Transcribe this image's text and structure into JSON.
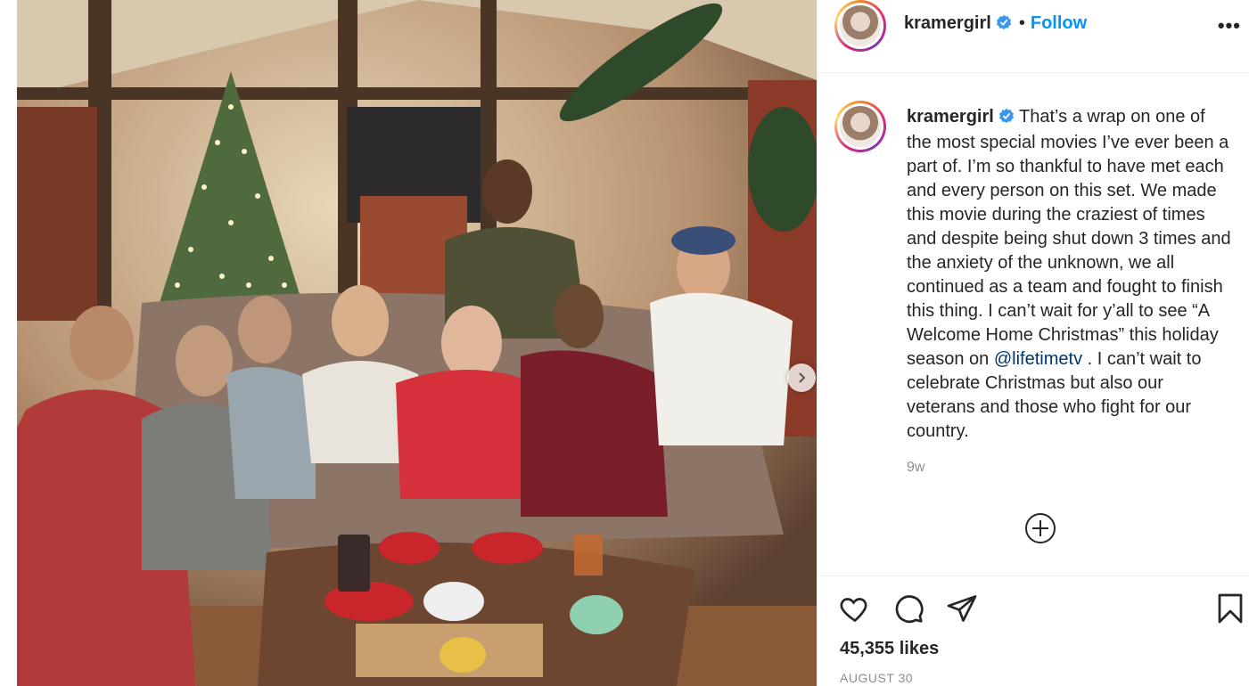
{
  "post": {
    "username": "kramergirl",
    "follow_label": "Follow",
    "dot_separator": "•",
    "more_label": "•••",
    "caption_username": "kramergirl",
    "caption_part1": " That’s a wrap on one of the most special movies I’ve ever been a part of. I’m so thankful to have met each and every person on this set. We made this movie during the craziest of times and despite being shut down 3 times and the anxiety of the unknown, we all continued as a team and fought to finish this thing. I can’t wait for y’all to see “A Welcome Home Christmas” this holiday season on ",
    "mention": "@lifetimetv",
    "caption_part2": " . I can’t wait to celebrate Christmas but also our veterans and those who fight for our country.",
    "age": "9w",
    "likes": "45,355 likes",
    "date": "AUGUST 30"
  },
  "icons": {
    "verified": "verified-badge-icon",
    "next": "chevron-right-icon",
    "load_more": "plus-circle-icon",
    "like": "heart-icon",
    "comment": "comment-bubble-icon",
    "share": "paper-plane-icon",
    "save": "bookmark-icon"
  },
  "colors": {
    "follow": "#0095f6",
    "mention": "#00376b",
    "muted": "#8e8e8e",
    "verified": "#3897f0"
  }
}
